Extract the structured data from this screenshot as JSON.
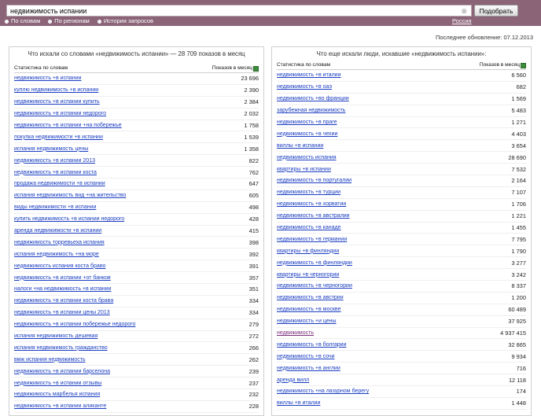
{
  "search": {
    "query": "недвижимость испании",
    "button": "Подобрать",
    "clear": "⊗"
  },
  "modes": [
    {
      "label": "По словам",
      "selected": true
    },
    {
      "label": "По регионам",
      "selected": false
    },
    {
      "label": "История запросов",
      "selected": false
    }
  ],
  "region": "Россия",
  "updated": "Последнее обновление: 07.12.2013",
  "left": {
    "title": "Что искали со словами «недвижимость испании» — 28 709 показов в месяц",
    "col_query": "Статистика по словам",
    "col_count": "Показов в месяц",
    "rows": [
      {
        "q": "недвижимость +в испании",
        "n": "23 696"
      },
      {
        "q": "куплю недвижимость +в испании",
        "n": "2 390"
      },
      {
        "q": "недвижимость +в испании купить",
        "n": "2 384"
      },
      {
        "q": "недвижимость +в испании недорого",
        "n": "2 032"
      },
      {
        "q": "недвижимость +в испании +на побережье",
        "n": "1 758"
      },
      {
        "q": "покупка недвижимости +в испании",
        "n": "1 539"
      },
      {
        "q": "испания недвижимость цены",
        "n": "1 358"
      },
      {
        "q": "недвижимость +в испании 2013",
        "n": "822"
      },
      {
        "q": "недвижимость +в испании коста",
        "n": "762"
      },
      {
        "q": "продажа недвижимости +в испании",
        "n": "647"
      },
      {
        "q": "испания недвижимость вид +на жительство",
        "n": "605"
      },
      {
        "q": "виды недвижимости +в испании",
        "n": "498"
      },
      {
        "q": "купить недвижимость +в испании недорого",
        "n": "428"
      },
      {
        "q": "аренда недвижимости +в испании",
        "n": "415"
      },
      {
        "q": "недвижимость торревьеха испания",
        "n": "398"
      },
      {
        "q": "испания недвижимость +на море",
        "n": "392"
      },
      {
        "q": "недвижимость испания коста браво",
        "n": "391"
      },
      {
        "q": "недвижимость +в испании +от банков",
        "n": "357"
      },
      {
        "q": "налоги +на недвижимость +в испании",
        "n": "351"
      },
      {
        "q": "недвижимость +в испании коста брава",
        "n": "334"
      },
      {
        "q": "недвижимость +в испании цены 2013",
        "n": "334"
      },
      {
        "q": "недвижимость +в испании побережье недорого",
        "n": "279"
      },
      {
        "q": "испания недвижимость дешевая",
        "n": "272"
      },
      {
        "q": "испания недвижимость гражданство",
        "n": "266"
      },
      {
        "q": "вмж испания недвижимость",
        "n": "262"
      },
      {
        "q": "недвижимость +в испании барселона",
        "n": "239"
      },
      {
        "q": "недвижимость +в испании отзывы",
        "n": "237"
      },
      {
        "q": "недвижимость марбелья испания",
        "n": "232"
      },
      {
        "q": "недвижимость +в испании аликанте",
        "n": "228"
      }
    ]
  },
  "right": {
    "title": "Что еще искали люди, искавшие «недвижимость испании»:",
    "col_query": "Статистика по словам",
    "col_count": "Показов в месяц",
    "rows": [
      {
        "q": "недвижимость +в италии",
        "n": "6 560"
      },
      {
        "q": "недвижимость +в оаэ",
        "n": "682"
      },
      {
        "q": "недвижимость +во франции",
        "n": "1 569"
      },
      {
        "q": "зарубежная недвижимость",
        "n": "5 483"
      },
      {
        "q": "недвижимость +в праге",
        "n": "1 271"
      },
      {
        "q": "недвижимость +в чехии",
        "n": "4 403"
      },
      {
        "q": "виллы +в испании",
        "n": "3 654"
      },
      {
        "q": "недвижимость испания",
        "n": "28 690"
      },
      {
        "q": "квартиры +в испании",
        "n": "7 532"
      },
      {
        "q": "недвижимость +в португалии",
        "n": "2 164"
      },
      {
        "q": "недвижимость +в турции",
        "n": "7 107"
      },
      {
        "q": "недвижимость +в хорватии",
        "n": "1 706"
      },
      {
        "q": "недвижимость +в австралии",
        "n": "1 221"
      },
      {
        "q": "недвижимость +в канаде",
        "n": "1 455"
      },
      {
        "q": "недвижимость +в германии",
        "n": "7 795"
      },
      {
        "q": "квартиры +в финляндии",
        "n": "1 790"
      },
      {
        "q": "недвижимость +в финляндии",
        "n": "3 277"
      },
      {
        "q": "квартиры +в черногории",
        "n": "3 242"
      },
      {
        "q": "недвижимость +в черногории",
        "n": "8 337"
      },
      {
        "q": "недвижимость +в австрии",
        "n": "1 200"
      },
      {
        "q": "недвижимость +в москве",
        "n": "60 489"
      },
      {
        "q": "недвижимость +и цены",
        "n": "37 925"
      },
      {
        "q": "недвижимость",
        "n": "4 937 415",
        "visited": true
      },
      {
        "q": "недвижимость +в болгарии",
        "n": "32 865"
      },
      {
        "q": "недвижимость +в сочи",
        "n": "9 934"
      },
      {
        "q": "недвижимость +в англии",
        "n": "716"
      },
      {
        "q": "аренда вилл",
        "n": "12 118"
      },
      {
        "q": "недвижимость +на лазурном берегу",
        "n": "174"
      },
      {
        "q": "виллы +в италии",
        "n": "1 448"
      }
    ]
  }
}
